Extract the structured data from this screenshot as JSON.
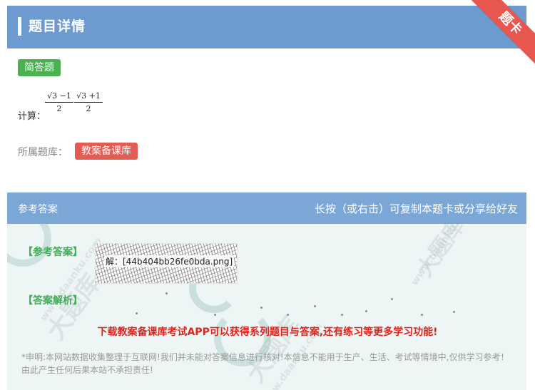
{
  "header": {
    "title": "题目详情",
    "ribbon_label": "题卡"
  },
  "question": {
    "type_tag": "简答题",
    "prompt_label": "计算：",
    "formula_parts": [
      {
        "numerator": "√3 −1",
        "denominator": "2"
      },
      {
        "numerator": "√3 +1",
        "denominator": "2"
      }
    ],
    "bank_label": "所属题库：",
    "bank_tag": "教案备课库"
  },
  "answer": {
    "section_label": "参考答案",
    "share_hint": "长按（或右击）可复制本题卡或分享给好友",
    "reference_label": "【参考答案】",
    "reference_image_alt": "解：[44b404bb26fe0bda.png]",
    "analysis_label": "【答案解析】",
    "promo_text": "下载教案备课库考试APP可以获得系列题目与答案,还有练习等更多学习功能!",
    "disclaimer": "*申明:本网站数据收集整理于互联网!我们并未能对答案信息进行核对!本信息不能用于生产、生活、考试等情境中,仅供学习参考！由此产生任何后果本站不承担责任!"
  },
  "watermarks": [
    "大题库",
    "www.daanku.com"
  ],
  "colors": {
    "header_bg": "#6d9bd0",
    "answer_header_bg": "#7aa7d6",
    "green_tag": "#49b14f",
    "red_tag": "#e35c53",
    "promo_red": "#e0241b",
    "answer_body_bg": "#eef5f5"
  }
}
